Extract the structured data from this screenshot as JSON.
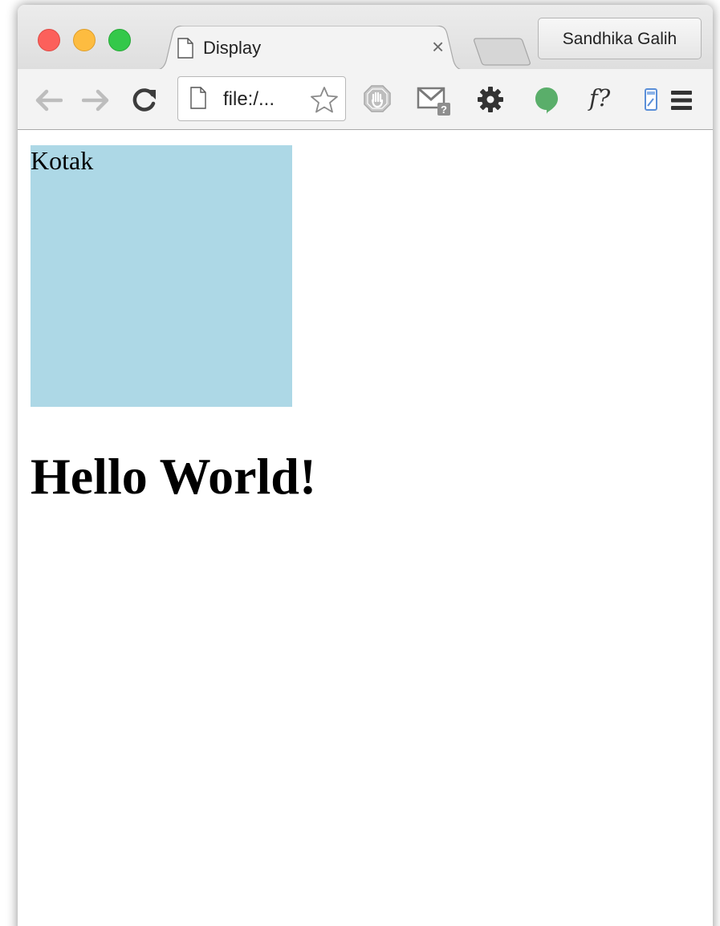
{
  "browser": {
    "tab": {
      "title": "Display",
      "close_glyph": "×",
      "favicon": "page-icon"
    },
    "profile_name": "Sandhika Galih",
    "toolbar": {
      "back_icon": "back-arrow-icon",
      "forward_icon": "forward-arrow-icon",
      "reload_icon": "reload-icon",
      "address_text": "file:/...",
      "extensions": [
        "adblock-icon",
        "mail-checker-icon",
        "gear-icon",
        "hangouts-icon",
        "f-question-icon",
        "bookmark-manager-icon",
        "menu-icon"
      ],
      "font_ext_label": "f?"
    }
  },
  "page": {
    "box_label": "Kotak",
    "heading": "Hello World!",
    "box_color": "#add8e6"
  }
}
